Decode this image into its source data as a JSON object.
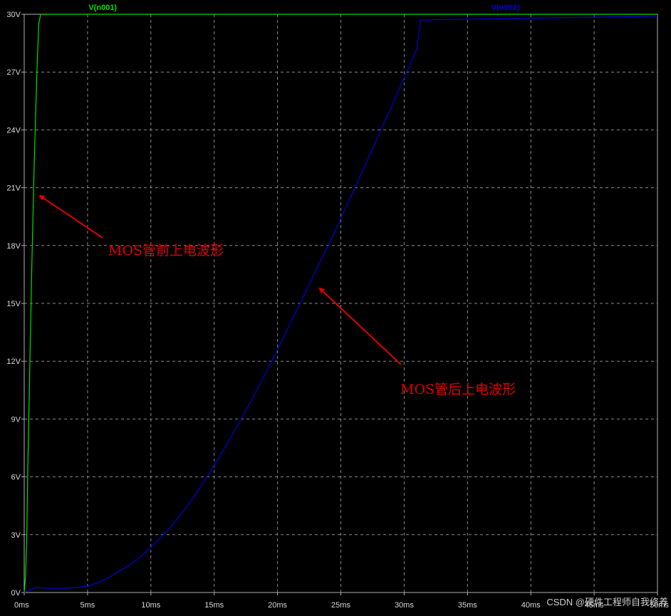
{
  "chart_data": {
    "type": "line",
    "title": "",
    "xlabel": "",
    "ylabel": "",
    "xlim": [
      0,
      50
    ],
    "ylim": [
      0,
      30
    ],
    "grid": true,
    "background": "#000000",
    "x_ticks": [
      "0ms",
      "5ms",
      "10ms",
      "15ms",
      "20ms",
      "25ms",
      "30ms",
      "35ms",
      "40ms",
      "45ms",
      "50ms"
    ],
    "y_ticks": [
      "0V",
      "3V",
      "6V",
      "9V",
      "12V",
      "15V",
      "18V",
      "21V",
      "24V",
      "27V",
      "30V"
    ],
    "series": [
      {
        "name": "V(n001)",
        "color": "#00e000",
        "x": [
          0,
          0.1,
          0.2,
          0.3,
          0.45,
          0.6,
          0.8,
          1.0,
          1.15,
          1.3,
          50
        ],
        "y": [
          0,
          0.8,
          3.0,
          7.0,
          12.0,
          17.0,
          22.5,
          27.0,
          29.5,
          30.0,
          30.0
        ]
      },
      {
        "name": "V(n002)",
        "color": "#0000e0",
        "x": [
          0,
          1.0,
          1.2,
          2.0,
          3.0,
          4.0,
          5.0,
          6.0,
          7.0,
          8.0,
          9.0,
          10.0,
          11.0,
          12.0,
          13.0,
          14.0,
          15.0,
          16.0,
          17.0,
          18.0,
          19.0,
          20.0,
          21.0,
          22.0,
          23.0,
          24.0,
          25.0,
          26.0,
          27.0,
          28.0,
          29.0,
          30.0,
          31.0,
          31.3,
          35.0,
          40.0,
          45.0,
          50.0
        ],
        "y": [
          0.0,
          0.28,
          0.25,
          0.22,
          0.22,
          0.25,
          0.33,
          0.55,
          0.9,
          1.3,
          1.75,
          2.35,
          3.0,
          3.75,
          4.6,
          5.55,
          6.6,
          7.7,
          8.85,
          10.05,
          11.3,
          12.6,
          13.95,
          15.3,
          16.65,
          18.0,
          19.4,
          20.85,
          22.3,
          23.75,
          25.2,
          26.7,
          28.2,
          29.7,
          29.75,
          29.8,
          29.85,
          29.9
        ]
      }
    ],
    "annotations": [
      {
        "text": "MOS管前上电波形",
        "color": "#e00000",
        "arrow_to": [
          1.2,
          20.6
        ]
      },
      {
        "text": "MOS管后上电波形",
        "color": "#e00000",
        "arrow_to": [
          23.3,
          15.8
        ]
      }
    ],
    "watermark": "CSDN @硬件工程师自我修养"
  }
}
